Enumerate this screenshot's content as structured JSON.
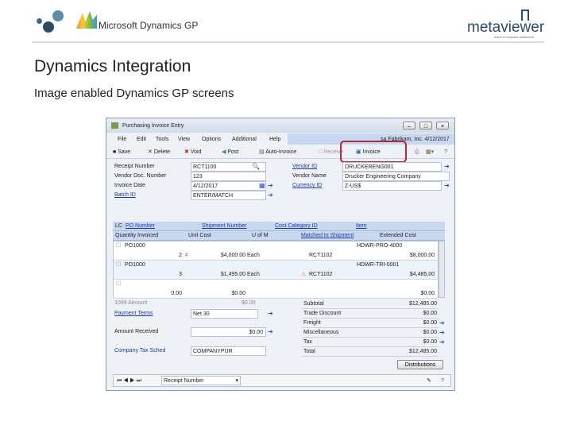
{
  "slide": {
    "title": "Dynamics Integration",
    "subtitle": "Image enabled Dynamics GP screens",
    "logo_left": "Microsoft Dynamics GP",
    "logo_right": "metaviewer",
    "logo_right_tagline": "travel to expense settlement"
  },
  "window": {
    "title": "Purchasing Invoice Entry",
    "menu": [
      "File",
      "Edit",
      "Tools",
      "View",
      "Options",
      "Additional",
      "Help"
    ],
    "company": "sa Fabrikam, Inc. 4/12/2017",
    "toolbar": {
      "save": "Save",
      "delete": "Delete",
      "void": "Void",
      "post": "Post",
      "auto_invoice": "Auto-Invoice",
      "receive": "Receive",
      "invoice": "Invoice"
    },
    "header": {
      "receipt_number_label": "Receipt Number",
      "receipt_number": "RCT1100",
      "vendor_doc_label": "Vendor Doc. Number",
      "vendor_doc": "123",
      "invoice_date_label": "Invoice Date",
      "invoice_date": "4/12/2017",
      "batch_id_label": "Batch ID",
      "batch_id": "ENTER/MATCH",
      "vendor_id_label": "Vendor ID",
      "vendor_id": "DRUCKERENG001",
      "vendor_name_label": "Vendor Name",
      "vendor_name": "Drucker Engineering Company",
      "currency_id_label": "Currency ID",
      "currency_id": "Z-US$"
    },
    "grid": {
      "h1": [
        "LC",
        "PO Number",
        "Shipment Number",
        "Cost Category ID",
        "Item"
      ],
      "h2": [
        "Quantity Invoiced",
        "Unit Cost",
        "U of M",
        "Matched to Shipment",
        "Extended Cost"
      ],
      "rows": [
        {
          "po": "PO1000",
          "item": "HDWR-PRO-4000",
          "qty": "2",
          "unit_cost": "$4,000.00",
          "uom": "Each",
          "shipment": "RCT1102",
          "ext": "$8,000.00"
        },
        {
          "po": "PO1000",
          "item": "HDWR-TRI-0001",
          "qty": "3",
          "unit_cost": "$1,495.00",
          "uom": "Each",
          "shipment": "RCT1102",
          "ext": "$4,485.00"
        },
        {
          "po": "",
          "item": "",
          "qty": "0.00",
          "unit_cost": "$0.00",
          "uom": "",
          "shipment": "",
          "ext": "$0.00"
        }
      ]
    },
    "footer": {
      "tax_amount_label": "1099 Amount",
      "tax_amount": "$0.00",
      "payment_terms_label": "Payment Terms",
      "payment_terms": "Net 30",
      "amount_received_label": "Amount Received",
      "amount_received": "$0.00",
      "tax_schedule_label": "Company Tax Sched",
      "tax_schedule": "COMPANYPUR",
      "totals": [
        [
          "Subtotal",
          "$12,485.00"
        ],
        [
          "Trade Discount",
          "$0.00"
        ],
        [
          "Freight",
          "$0.00"
        ],
        [
          "Miscellaneous",
          "$0.00"
        ],
        [
          "Tax",
          "$0.00"
        ],
        [
          "Total",
          "$12,485.00"
        ]
      ],
      "distributions": "Distributions",
      "sort": "Receipt Number"
    }
  },
  "colors": {
    "highlight": "#b02a37",
    "link": "#1a3aa8"
  }
}
